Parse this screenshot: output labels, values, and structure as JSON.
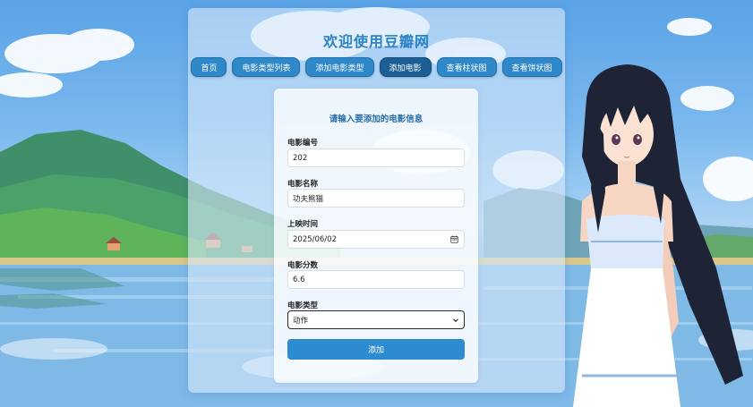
{
  "site": {
    "title": "欢迎使用豆瓣网"
  },
  "nav": {
    "items": [
      {
        "label": "首页"
      },
      {
        "label": "电影类型列表"
      },
      {
        "label": "添加电影类型"
      },
      {
        "label": "添加电影",
        "active": true
      },
      {
        "label": "查看柱状图"
      },
      {
        "label": "查看饼状图"
      }
    ]
  },
  "form": {
    "heading": "请输入要添加的电影信息",
    "fields": {
      "id": {
        "label": "电影编号",
        "value": "202"
      },
      "name": {
        "label": "电影名称",
        "value": "功夫熊猫"
      },
      "release": {
        "label": "上映时间",
        "value": "2025/06/02"
      },
      "score": {
        "label": "电影分数",
        "value": "6.6"
      },
      "type": {
        "label": "电影类型",
        "value": "动作"
      }
    },
    "submit_label": "添加"
  },
  "colors": {
    "accent": "#2f88c8",
    "active": "#1d5f94",
    "title": "#2b83c6"
  },
  "icons": [
    "calendar-icon",
    "chevron-down-icon"
  ]
}
